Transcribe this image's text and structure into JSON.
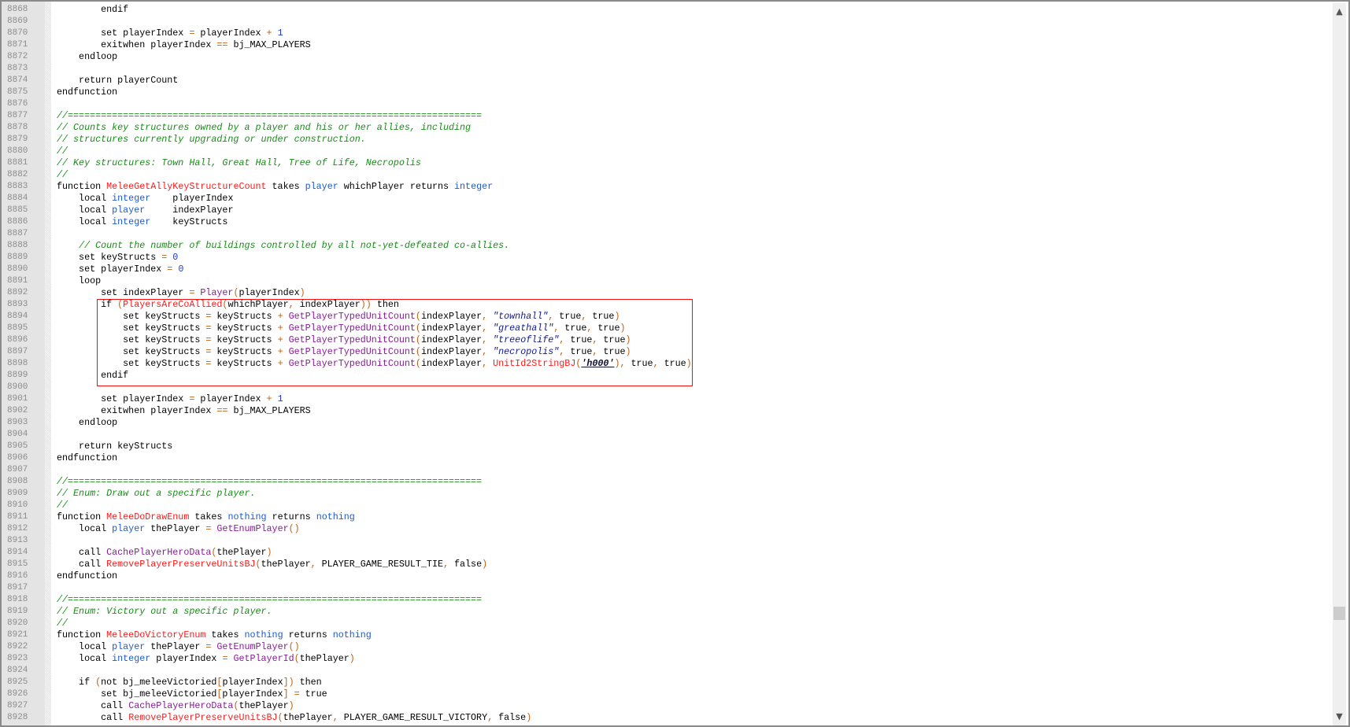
{
  "editor": {
    "scrollbar": {
      "up_icon": "chevron-up-icon",
      "down_icon": "chevron-down-icon",
      "position_fraction": 0.84
    },
    "highlight_color": "#f01010",
    "lines": [
      {
        "n": "8868",
        "t": [
          [
            "k",
            "        endif"
          ]
        ]
      },
      {
        "n": "8869",
        "t": []
      },
      {
        "n": "8870",
        "t": [
          [
            "k",
            "        set playerIndex "
          ],
          [
            "o",
            "="
          ],
          [
            "k",
            " playerIndex "
          ],
          [
            "o",
            "+"
          ],
          [
            "k",
            " "
          ],
          [
            "d",
            "1"
          ]
        ]
      },
      {
        "n": "8871",
        "t": [
          [
            "k",
            "        exitwhen playerIndex "
          ],
          [
            "o",
            "=="
          ],
          [
            "k",
            " bj_MAX_PLAYERS"
          ]
        ]
      },
      {
        "n": "8872",
        "t": [
          [
            "k",
            "    endloop"
          ]
        ]
      },
      {
        "n": "8873",
        "t": []
      },
      {
        "n": "8874",
        "t": [
          [
            "k",
            "    return playerCount"
          ]
        ]
      },
      {
        "n": "8875",
        "t": [
          [
            "k",
            "endfunction"
          ]
        ]
      },
      {
        "n": "8876",
        "t": []
      },
      {
        "n": "8877",
        "t": [
          [
            "c",
            "//==========================================================================="
          ]
        ]
      },
      {
        "n": "8878",
        "t": [
          [
            "c",
            "// Counts key structures owned by a player and his or her allies, including"
          ]
        ]
      },
      {
        "n": "8879",
        "t": [
          [
            "c",
            "// structures currently upgrading or under construction."
          ]
        ]
      },
      {
        "n": "8880",
        "t": [
          [
            "c",
            "//"
          ]
        ]
      },
      {
        "n": "8881",
        "t": [
          [
            "c",
            "// Key structures: Town Hall, Great Hall, Tree of Life, Necropolis"
          ]
        ]
      },
      {
        "n": "8882",
        "t": [
          [
            "c",
            "//"
          ]
        ]
      },
      {
        "n": "8883",
        "t": [
          [
            "k",
            "function "
          ],
          [
            "f",
            "MeleeGetAllyKeyStructureCount"
          ],
          [
            "k",
            " takes "
          ],
          [
            "t",
            "player"
          ],
          [
            "k",
            " whichPlayer returns "
          ],
          [
            "t",
            "integer"
          ]
        ]
      },
      {
        "n": "8884",
        "t": [
          [
            "k",
            "    local "
          ],
          [
            "t",
            "integer"
          ],
          [
            "k",
            "    playerIndex"
          ]
        ]
      },
      {
        "n": "8885",
        "t": [
          [
            "k",
            "    local "
          ],
          [
            "t",
            "player"
          ],
          [
            "k",
            "     indexPlayer"
          ]
        ]
      },
      {
        "n": "8886",
        "t": [
          [
            "k",
            "    local "
          ],
          [
            "t",
            "integer"
          ],
          [
            "k",
            "    keyStructs"
          ]
        ]
      },
      {
        "n": "8887",
        "t": []
      },
      {
        "n": "8888",
        "t": [
          [
            "k",
            "    "
          ],
          [
            "c",
            "// Count the number of buildings controlled by all not-yet-defeated co-allies."
          ]
        ]
      },
      {
        "n": "8889",
        "t": [
          [
            "k",
            "    set keyStructs "
          ],
          [
            "o",
            "="
          ],
          [
            "k",
            " "
          ],
          [
            "d",
            "0"
          ]
        ]
      },
      {
        "n": "8890",
        "t": [
          [
            "k",
            "    set playerIndex "
          ],
          [
            "o",
            "="
          ],
          [
            "k",
            " "
          ],
          [
            "d",
            "0"
          ]
        ]
      },
      {
        "n": "8891",
        "t": [
          [
            "k",
            "    loop"
          ]
        ]
      },
      {
        "n": "8892",
        "t": [
          [
            "k",
            "        set indexPlayer "
          ],
          [
            "o",
            "="
          ],
          [
            "k",
            " "
          ],
          [
            "n",
            "Player"
          ],
          [
            "o",
            "("
          ],
          [
            "k",
            "playerIndex"
          ],
          [
            "o",
            ")"
          ]
        ]
      },
      {
        "n": "8893",
        "t": [
          [
            "k",
            "        if "
          ],
          [
            "o",
            "("
          ],
          [
            "f",
            "PlayersAreCoAllied"
          ],
          [
            "o",
            "("
          ],
          [
            "k",
            "whichPlayer"
          ],
          [
            "o",
            ","
          ],
          [
            "k",
            " indexPlayer"
          ],
          [
            "o",
            "))"
          ],
          [
            "k",
            " then"
          ]
        ]
      },
      {
        "n": "8894",
        "t": [
          [
            "k",
            "            set keyStructs "
          ],
          [
            "o",
            "="
          ],
          [
            "k",
            " keyStructs "
          ],
          [
            "o",
            "+"
          ],
          [
            "k",
            " "
          ],
          [
            "n",
            "GetPlayerTypedUnitCount"
          ],
          [
            "o",
            "("
          ],
          [
            "k",
            "indexPlayer"
          ],
          [
            "o",
            ","
          ],
          [
            "k",
            " "
          ],
          [
            "s",
            "\"townhall\""
          ],
          [
            "o",
            ","
          ],
          [
            "k",
            " true"
          ],
          [
            "o",
            ","
          ],
          [
            "k",
            " true"
          ],
          [
            "o",
            ")"
          ]
        ]
      },
      {
        "n": "8895",
        "t": [
          [
            "k",
            "            set keyStructs "
          ],
          [
            "o",
            "="
          ],
          [
            "k",
            " keyStructs "
          ],
          [
            "o",
            "+"
          ],
          [
            "k",
            " "
          ],
          [
            "n",
            "GetPlayerTypedUnitCount"
          ],
          [
            "o",
            "("
          ],
          [
            "k",
            "indexPlayer"
          ],
          [
            "o",
            ","
          ],
          [
            "k",
            " "
          ],
          [
            "s",
            "\"greathall\""
          ],
          [
            "o",
            ","
          ],
          [
            "k",
            " true"
          ],
          [
            "o",
            ","
          ],
          [
            "k",
            " true"
          ],
          [
            "o",
            ")"
          ]
        ]
      },
      {
        "n": "8896",
        "t": [
          [
            "k",
            "            set keyStructs "
          ],
          [
            "o",
            "="
          ],
          [
            "k",
            " keyStructs "
          ],
          [
            "o",
            "+"
          ],
          [
            "k",
            " "
          ],
          [
            "n",
            "GetPlayerTypedUnitCount"
          ],
          [
            "o",
            "("
          ],
          [
            "k",
            "indexPlayer"
          ],
          [
            "o",
            ","
          ],
          [
            "k",
            " "
          ],
          [
            "s",
            "\"treeoflife\""
          ],
          [
            "o",
            ","
          ],
          [
            "k",
            " true"
          ],
          [
            "o",
            ","
          ],
          [
            "k",
            " true"
          ],
          [
            "o",
            ")"
          ]
        ]
      },
      {
        "n": "8897",
        "t": [
          [
            "k",
            "            set keyStructs "
          ],
          [
            "o",
            "="
          ],
          [
            "k",
            " keyStructs "
          ],
          [
            "o",
            "+"
          ],
          [
            "k",
            " "
          ],
          [
            "n",
            "GetPlayerTypedUnitCount"
          ],
          [
            "o",
            "("
          ],
          [
            "k",
            "indexPlayer"
          ],
          [
            "o",
            ","
          ],
          [
            "k",
            " "
          ],
          [
            "s",
            "\"necropolis\""
          ],
          [
            "o",
            ","
          ],
          [
            "k",
            " true"
          ],
          [
            "o",
            ","
          ],
          [
            "k",
            " true"
          ],
          [
            "o",
            ")"
          ]
        ]
      },
      {
        "n": "8898",
        "t": [
          [
            "k",
            "            set keyStructs "
          ],
          [
            "o",
            "="
          ],
          [
            "k",
            " keyStructs "
          ],
          [
            "o",
            "+"
          ],
          [
            "k",
            " "
          ],
          [
            "n",
            "GetPlayerTypedUnitCount"
          ],
          [
            "o",
            "("
          ],
          [
            "k",
            "indexPlayer"
          ],
          [
            "o",
            ","
          ],
          [
            "k",
            " "
          ],
          [
            "f",
            "UnitId2StringBJ"
          ],
          [
            "o",
            "("
          ],
          [
            "r",
            "'h000'"
          ],
          [
            "o",
            "),"
          ],
          [
            "k",
            " true"
          ],
          [
            "o",
            ","
          ],
          [
            "k",
            " true"
          ],
          [
            "o",
            ")"
          ]
        ]
      },
      {
        "n": "8899",
        "t": [
          [
            "k",
            "        endif"
          ]
        ]
      },
      {
        "n": "8900",
        "t": []
      },
      {
        "n": "8901",
        "t": [
          [
            "k",
            "        set playerIndex "
          ],
          [
            "o",
            "="
          ],
          [
            "k",
            " playerIndex "
          ],
          [
            "o",
            "+"
          ],
          [
            "k",
            " "
          ],
          [
            "d",
            "1"
          ]
        ]
      },
      {
        "n": "8902",
        "t": [
          [
            "k",
            "        exitwhen playerIndex "
          ],
          [
            "o",
            "=="
          ],
          [
            "k",
            " bj_MAX_PLAYERS"
          ]
        ]
      },
      {
        "n": "8903",
        "t": [
          [
            "k",
            "    endloop"
          ]
        ]
      },
      {
        "n": "8904",
        "t": []
      },
      {
        "n": "8905",
        "t": [
          [
            "k",
            "    return keyStructs"
          ]
        ]
      },
      {
        "n": "8906",
        "t": [
          [
            "k",
            "endfunction"
          ]
        ]
      },
      {
        "n": "8907",
        "t": []
      },
      {
        "n": "8908",
        "t": [
          [
            "c",
            "//==========================================================================="
          ]
        ]
      },
      {
        "n": "8909",
        "t": [
          [
            "c",
            "// Enum: Draw out a specific player."
          ]
        ]
      },
      {
        "n": "8910",
        "t": [
          [
            "c",
            "//"
          ]
        ]
      },
      {
        "n": "8911",
        "t": [
          [
            "k",
            "function "
          ],
          [
            "f",
            "MeleeDoDrawEnum"
          ],
          [
            "k",
            " takes "
          ],
          [
            "t",
            "nothing"
          ],
          [
            "k",
            " returns "
          ],
          [
            "t",
            "nothing"
          ]
        ]
      },
      {
        "n": "8912",
        "t": [
          [
            "k",
            "    local "
          ],
          [
            "t",
            "player"
          ],
          [
            "k",
            " thePlayer "
          ],
          [
            "o",
            "="
          ],
          [
            "k",
            " "
          ],
          [
            "n",
            "GetEnumPlayer"
          ],
          [
            "o",
            "()"
          ]
        ]
      },
      {
        "n": "8913",
        "t": []
      },
      {
        "n": "8914",
        "t": [
          [
            "k",
            "    call "
          ],
          [
            "n",
            "CachePlayerHeroData"
          ],
          [
            "o",
            "("
          ],
          [
            "k",
            "thePlayer"
          ],
          [
            "o",
            ")"
          ]
        ]
      },
      {
        "n": "8915",
        "t": [
          [
            "k",
            "    call "
          ],
          [
            "f",
            "RemovePlayerPreserveUnitsBJ"
          ],
          [
            "o",
            "("
          ],
          [
            "k",
            "thePlayer"
          ],
          [
            "o",
            ","
          ],
          [
            "k",
            " PLAYER_GAME_RESULT_TIE"
          ],
          [
            "o",
            ","
          ],
          [
            "k",
            " false"
          ],
          [
            "o",
            ")"
          ]
        ]
      },
      {
        "n": "8916",
        "t": [
          [
            "k",
            "endfunction"
          ]
        ]
      },
      {
        "n": "8917",
        "t": []
      },
      {
        "n": "8918",
        "t": [
          [
            "c",
            "//==========================================================================="
          ]
        ]
      },
      {
        "n": "8919",
        "t": [
          [
            "c",
            "// Enum: Victory out a specific player."
          ]
        ]
      },
      {
        "n": "8920",
        "t": [
          [
            "c",
            "//"
          ]
        ]
      },
      {
        "n": "8921",
        "t": [
          [
            "k",
            "function "
          ],
          [
            "f",
            "MeleeDoVictoryEnum"
          ],
          [
            "k",
            " takes "
          ],
          [
            "t",
            "nothing"
          ],
          [
            "k",
            " returns "
          ],
          [
            "t",
            "nothing"
          ]
        ]
      },
      {
        "n": "8922",
        "t": [
          [
            "k",
            "    local "
          ],
          [
            "t",
            "player"
          ],
          [
            "k",
            " thePlayer "
          ],
          [
            "o",
            "="
          ],
          [
            "k",
            " "
          ],
          [
            "n",
            "GetEnumPlayer"
          ],
          [
            "o",
            "()"
          ]
        ]
      },
      {
        "n": "8923",
        "t": [
          [
            "k",
            "    local "
          ],
          [
            "t",
            "integer"
          ],
          [
            "k",
            " playerIndex "
          ],
          [
            "o",
            "="
          ],
          [
            "k",
            " "
          ],
          [
            "n",
            "GetPlayerId"
          ],
          [
            "o",
            "("
          ],
          [
            "k",
            "thePlayer"
          ],
          [
            "o",
            ")"
          ]
        ]
      },
      {
        "n": "8924",
        "t": []
      },
      {
        "n": "8925",
        "t": [
          [
            "k",
            "    if "
          ],
          [
            "o",
            "("
          ],
          [
            "k",
            "not bj_meleeVictoried"
          ],
          [
            "o",
            "["
          ],
          [
            "k",
            "playerIndex"
          ],
          [
            "o",
            "])"
          ],
          [
            "k",
            " then"
          ]
        ]
      },
      {
        "n": "8926",
        "t": [
          [
            "k",
            "        set bj_meleeVictoried"
          ],
          [
            "o",
            "["
          ],
          [
            "k",
            "playerIndex"
          ],
          [
            "o",
            "]"
          ],
          [
            "k",
            " "
          ],
          [
            "o",
            "="
          ],
          [
            "k",
            " true"
          ]
        ]
      },
      {
        "n": "8927",
        "t": [
          [
            "k",
            "        call "
          ],
          [
            "n",
            "CachePlayerHeroData"
          ],
          [
            "o",
            "("
          ],
          [
            "k",
            "thePlayer"
          ],
          [
            "o",
            ")"
          ]
        ]
      },
      {
        "n": "8928",
        "t": [
          [
            "k",
            "        call "
          ],
          [
            "f",
            "RemovePlayerPreserveUnitsBJ"
          ],
          [
            "o",
            "("
          ],
          [
            "k",
            "thePlayer"
          ],
          [
            "o",
            ","
          ],
          [
            "k",
            " PLAYER_GAME_RESULT_VICTORY"
          ],
          [
            "o",
            ","
          ],
          [
            "k",
            " false"
          ],
          [
            "o",
            ")"
          ]
        ]
      }
    ]
  }
}
